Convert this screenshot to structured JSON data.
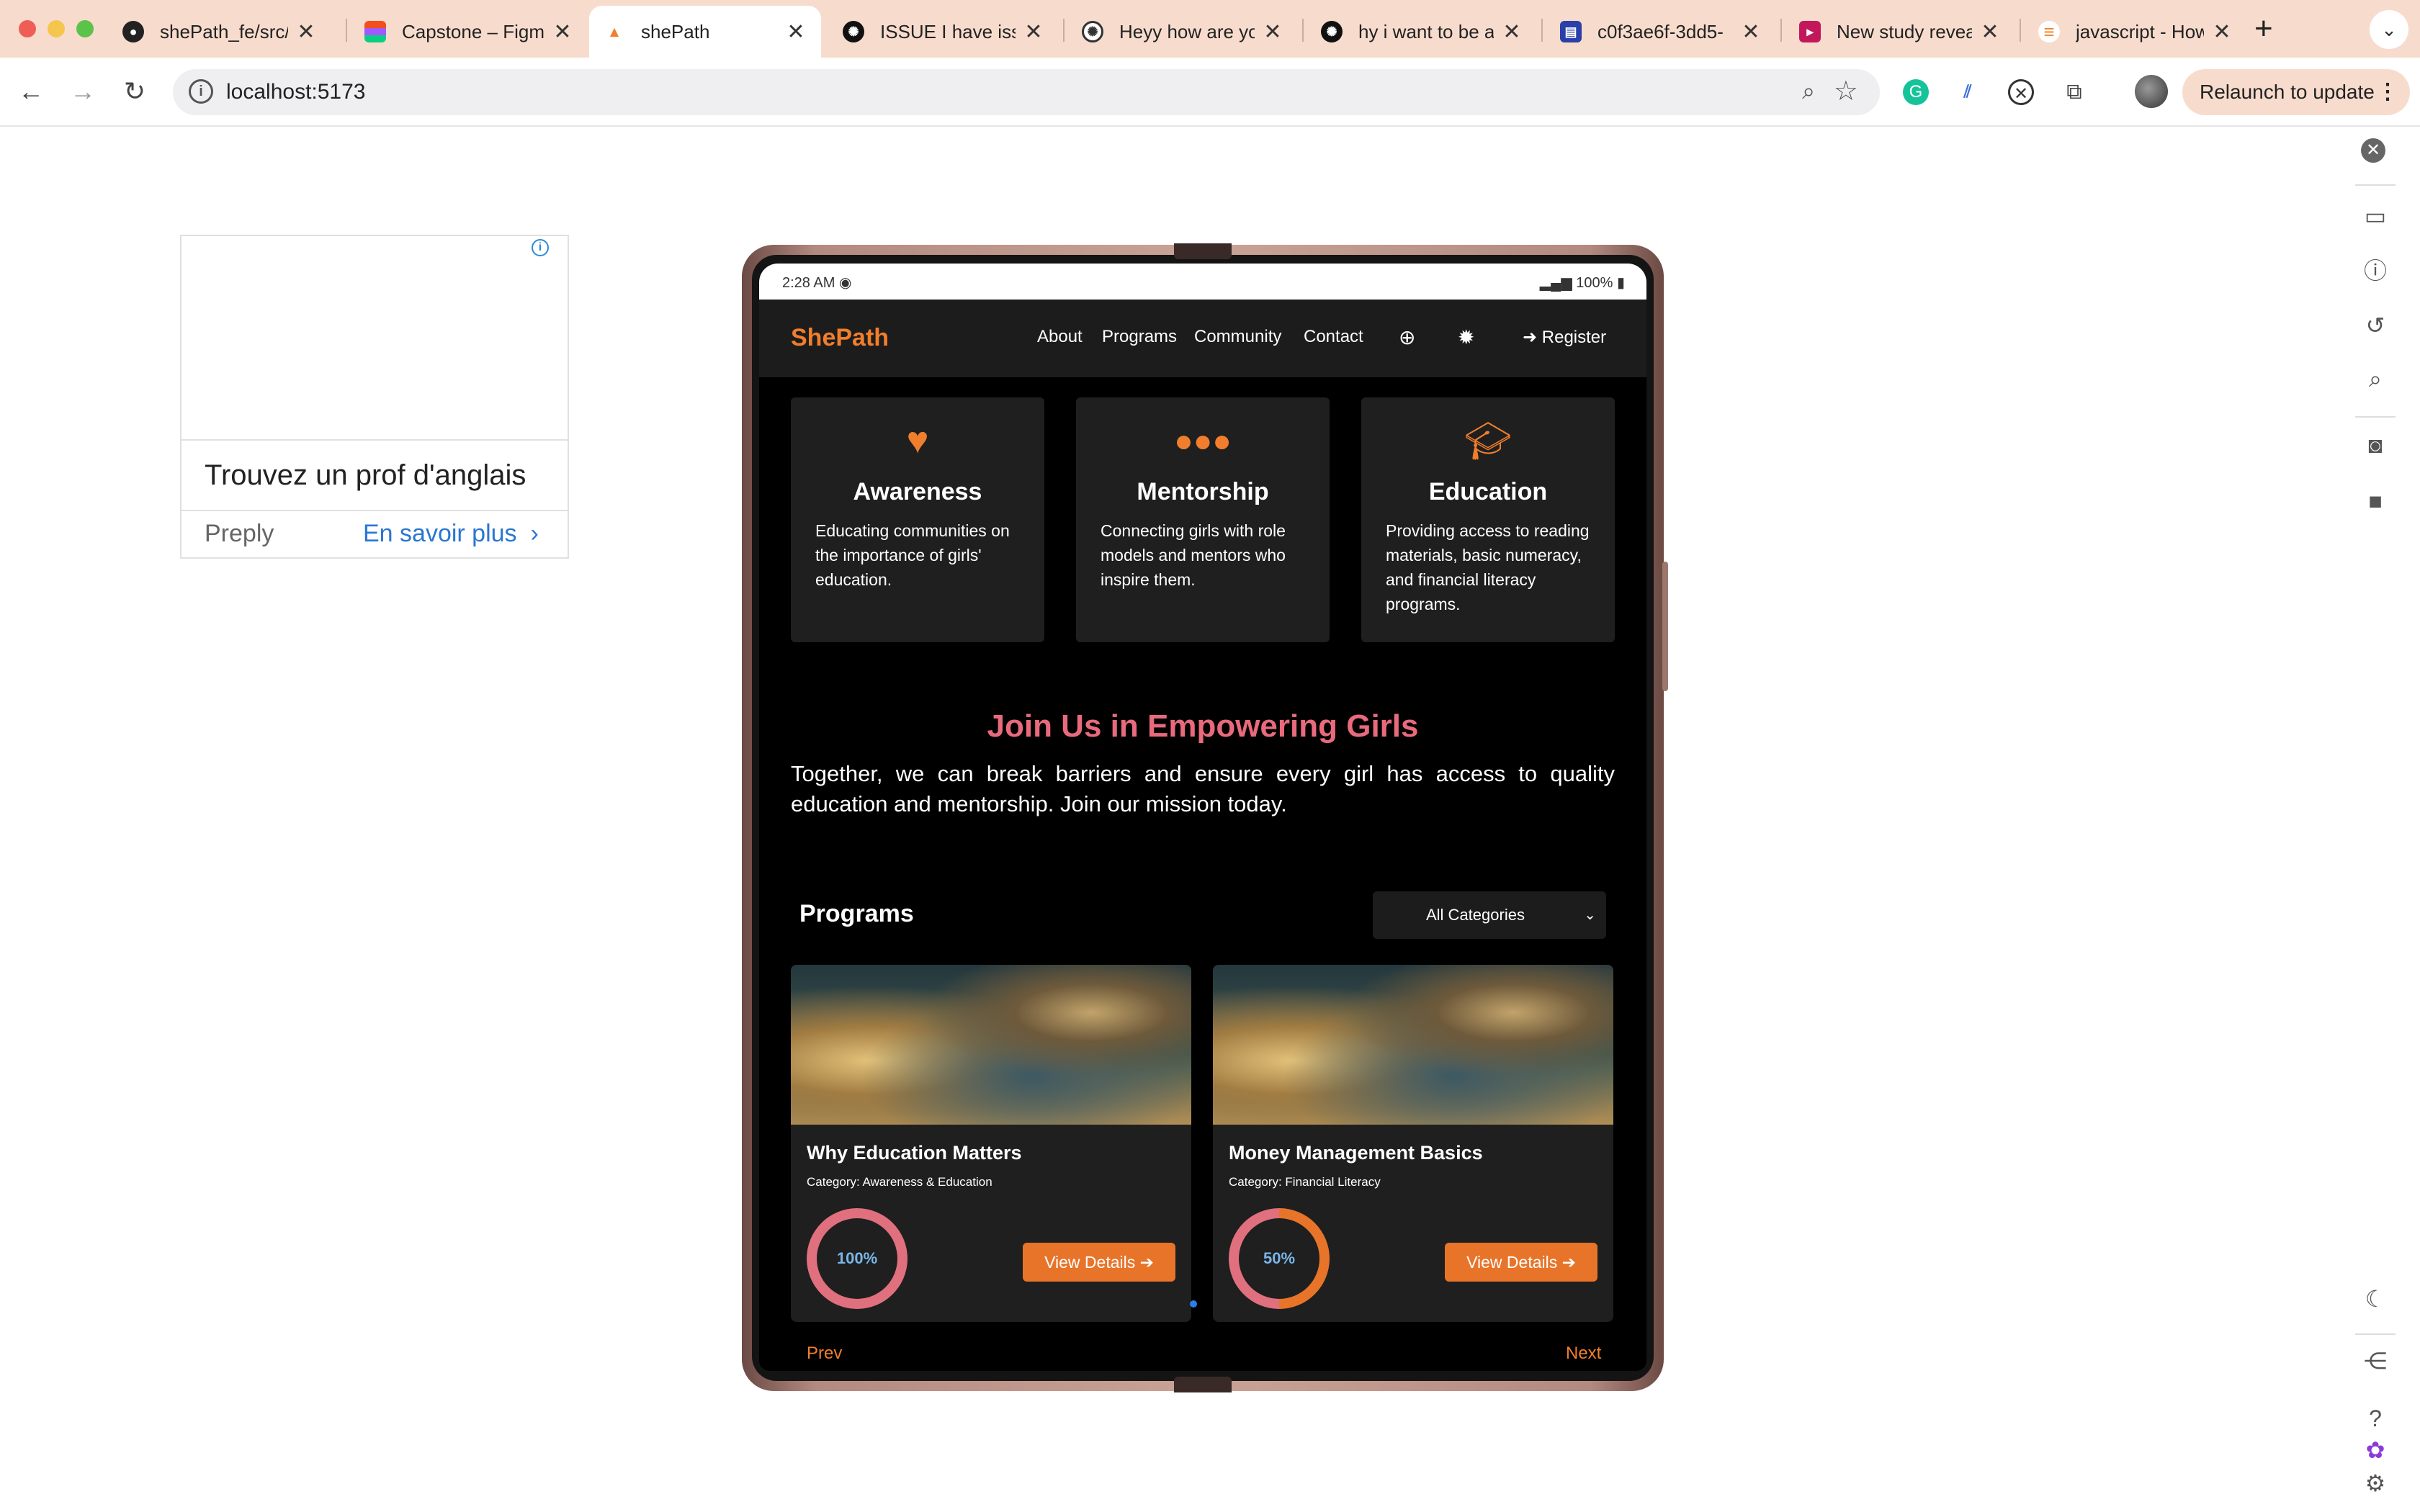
{
  "browser": {
    "tabs": [
      {
        "title": "shePath_fe/src/c",
        "favicon": "github-icon"
      },
      {
        "title": "Capstone – Figm",
        "favicon": "figma-icon"
      },
      {
        "title": "shePath",
        "favicon": "shepath-icon",
        "active": true
      },
      {
        "title": "ISSUE I have issu",
        "favicon": "openai-icon"
      },
      {
        "title": "Heyy how are yo",
        "favicon": "chatgpt-icon"
      },
      {
        "title": "hy i want to be a",
        "favicon": "openai-icon"
      },
      {
        "title": "c0f3ae6f-3dd5-",
        "favicon": "document-icon"
      },
      {
        "title": "New study revea",
        "favicon": "bookmark-icon"
      },
      {
        "title": "javascript - How",
        "favicon": "stackoverflow-icon"
      }
    ],
    "new_tab": "+",
    "url": "localhost:5173",
    "relaunch_label": "Relaunch to update"
  },
  "ad": {
    "headline": "Trouvez un prof d'anglais",
    "brand": "Preply",
    "cta": "En savoir plus"
  },
  "device": {
    "status_time": "2:28 AM",
    "status_battery": "100%"
  },
  "site": {
    "logo": "ShePath",
    "nav": [
      "About",
      "Programs",
      "Community",
      "Contact"
    ],
    "register": "Register",
    "cards": [
      {
        "icon": "heart-icon",
        "title": "Awareness",
        "desc": "Educating communities on the importance of girls' education."
      },
      {
        "icon": "users-icon",
        "title": "Mentorship",
        "desc": "Connecting girls with role models and mentors who inspire them."
      },
      {
        "icon": "graduation-cap-icon",
        "title": "Education",
        "desc": "Providing access to reading materials, basic numeracy, and financial literacy programs."
      }
    ],
    "join_title": "Join Us in Empowering Girls",
    "join_text": "Together, we can break barriers and ensure every girl has access to quality education and mentorship. Join our mission today.",
    "programs_heading": "Programs",
    "category_selected": "All Categories",
    "programs": [
      {
        "title": "Why Education Matters",
        "category": "Category: Awareness & Education",
        "progress_label": "100%",
        "progress": 1.0,
        "button": "View Details"
      },
      {
        "title": "Money Management Basics",
        "category": "Category: Financial Literacy",
        "progress_label": "50%",
        "progress": 0.5,
        "button": "View Details"
      }
    ],
    "prev": "Prev",
    "next": "Next"
  },
  "colors": {
    "accent_orange": "#f07e2c",
    "accent_pink": "#e86a7c",
    "ring_pink": "#e0707e",
    "ring_orange": "#e8742a"
  }
}
